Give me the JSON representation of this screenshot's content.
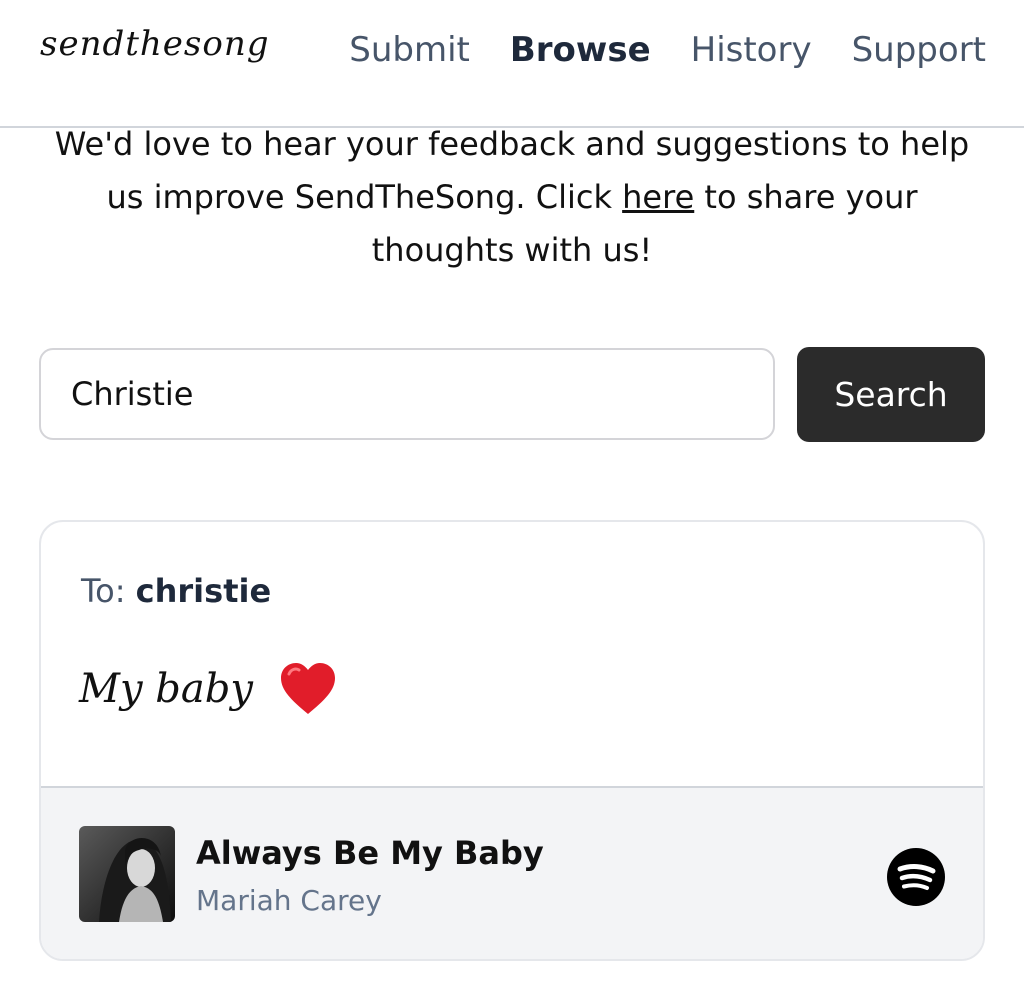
{
  "header": {
    "logo": "sendthesong",
    "nav": [
      "Submit",
      "Browse",
      "History",
      "Support"
    ],
    "active_nav": "Browse"
  },
  "feedback": {
    "before": "We'd love to hear your feedback and suggestions to help us improve SendTheSong. Click ",
    "link": "here",
    "after": " to share your thoughts with us!"
  },
  "search": {
    "value": "Christie",
    "button_label": "Search"
  },
  "card": {
    "to_label": "To:",
    "to_name": "christie",
    "message": "My baby",
    "message_emoji_icon": "red-heart-icon",
    "song": {
      "title": "Always Be My Baby",
      "artist": "Mariah Carey",
      "service_icon": "spotify-icon"
    }
  },
  "colors": {
    "search_button_bg": "#2b2b2b",
    "heart": "#e11d2a",
    "spotify": "#000000"
  }
}
